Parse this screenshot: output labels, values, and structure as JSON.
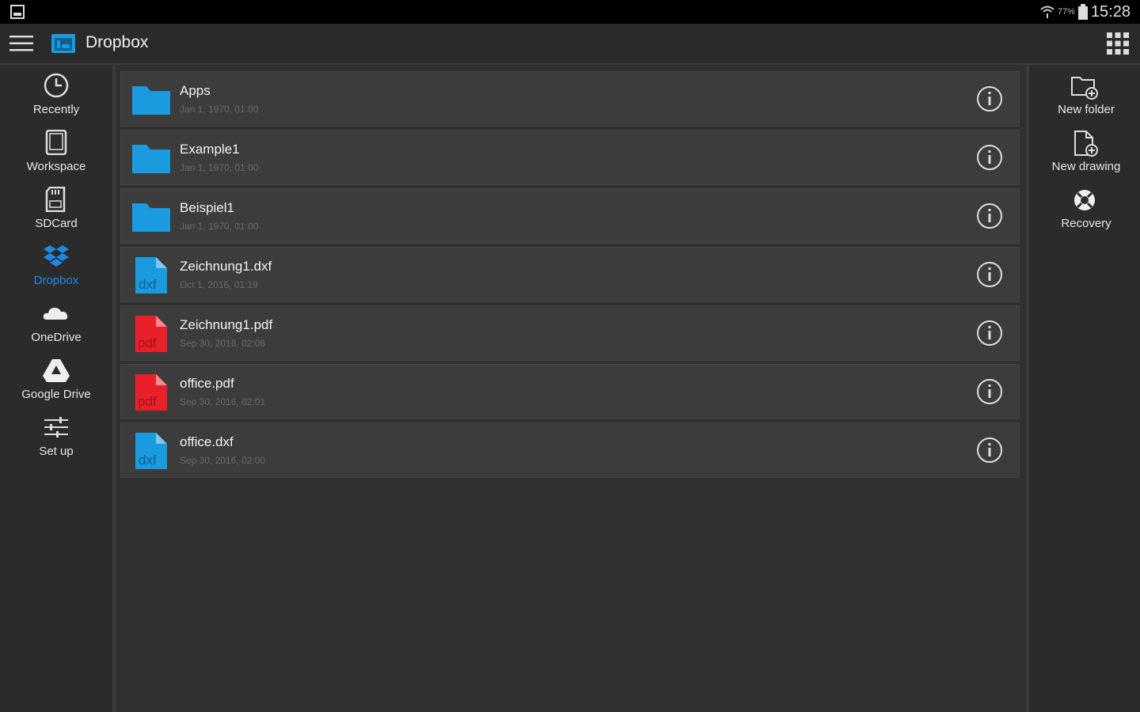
{
  "status_bar": {
    "battery_percent": "77%",
    "time": "15:28"
  },
  "toolbar": {
    "title": "Dropbox",
    "menu_icon": "hamburger-menu-icon",
    "app_icon": "dropbox-folder-icon",
    "grid_icon": "grid-apps-icon"
  },
  "left_nav": {
    "items": [
      {
        "label": "Recently",
        "icon": "clock-icon",
        "active": false
      },
      {
        "label": "Workspace",
        "icon": "tablet-icon",
        "active": false
      },
      {
        "label": "SDCard",
        "icon": "sdcard-icon",
        "active": false
      },
      {
        "label": "Dropbox",
        "icon": "dropbox-icon",
        "active": true
      },
      {
        "label": "OneDrive",
        "icon": "cloud-icon",
        "active": false
      },
      {
        "label": "Google Drive",
        "icon": "google-drive-icon",
        "active": false
      },
      {
        "label": "Set up",
        "icon": "sliders-icon",
        "active": false
      }
    ]
  },
  "files": [
    {
      "name": "Apps",
      "date": "Jan 1, 1970, 01:00",
      "type": "folder"
    },
    {
      "name": "Example1",
      "date": "Jan 1, 1970, 01:00",
      "type": "folder"
    },
    {
      "name": "Beispiel1",
      "date": "Jan 1, 1970, 01:00",
      "type": "folder"
    },
    {
      "name": "Zeichnung1.dxf",
      "date": "Oct 1, 2016, 01:19",
      "type": "dxf",
      "badge": "dxf"
    },
    {
      "name": "Zeichnung1.pdf",
      "date": "Sep 30, 2016, 02:06",
      "type": "pdf",
      "badge": "pdf"
    },
    {
      "name": "office.pdf",
      "date": "Sep 30, 2016, 02:01",
      "type": "pdf",
      "badge": "pdf"
    },
    {
      "name": "office.dxf",
      "date": "Sep 30, 2016, 02:00",
      "type": "dxf",
      "badge": "dxf"
    }
  ],
  "right_nav": {
    "items": [
      {
        "label": "New folder",
        "icon": "new-folder-icon"
      },
      {
        "label": "New drawing",
        "icon": "new-drawing-icon"
      },
      {
        "label": "Recovery",
        "icon": "lifebuoy-icon"
      }
    ]
  },
  "colors": {
    "accent": "#1e88e5",
    "folder": "#1a9be0",
    "dxf": "#1a9be0",
    "pdf": "#e8202a"
  }
}
